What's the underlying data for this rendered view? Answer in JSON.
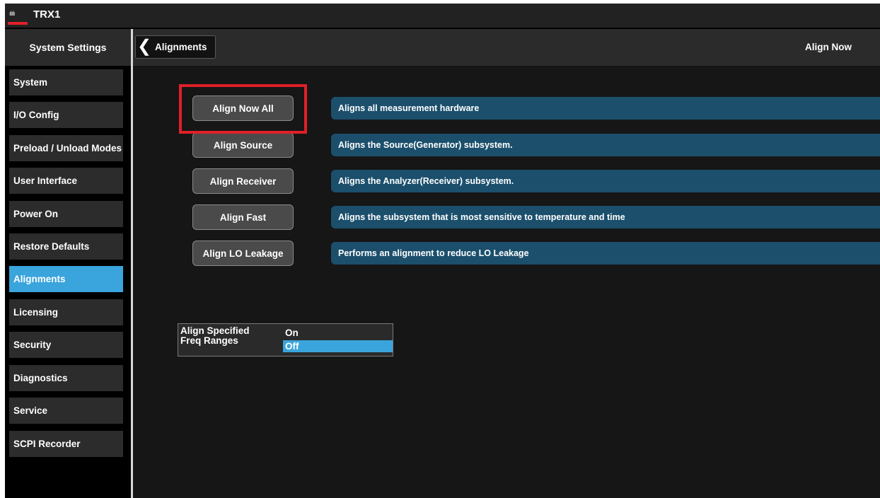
{
  "app": {
    "title": "TRX1",
    "logo_icon": "keysight-logo-icon",
    "accent_red": "#e0202a",
    "accent_blue": "#3aa4dc"
  },
  "sidebar": {
    "header": "System Settings",
    "items": [
      {
        "label": "System"
      },
      {
        "label": "I/O Config"
      },
      {
        "label": "Preload / Unload Modes"
      },
      {
        "label": "User Interface"
      },
      {
        "label": "Power On"
      },
      {
        "label": "Restore Defaults"
      },
      {
        "label": "Alignments",
        "active": true
      },
      {
        "label": "Licensing"
      },
      {
        "label": "Security"
      },
      {
        "label": "Diagnostics"
      },
      {
        "label": "Service"
      },
      {
        "label": "SCPI Recorder"
      }
    ]
  },
  "topbar": {
    "back_label": "Alignments",
    "back_icon": "chevron-left-icon",
    "right_label": "Align Now"
  },
  "align": {
    "rows": [
      {
        "button": "Align Now All",
        "desc": "Aligns all measurement hardware"
      },
      {
        "button": "Align Source",
        "desc": "Aligns the Source(Generator) subsystem."
      },
      {
        "button": "Align Receiver",
        "desc": "Aligns the Analyzer(Receiver) subsystem."
      },
      {
        "button": "Align Fast",
        "desc": "Aligns the subsystem that is most sensitive to temperature and time"
      },
      {
        "button": "Align LO Leakage",
        "desc": "Performs an alignment to reduce LO Leakage"
      }
    ]
  },
  "specified": {
    "label_line1": "Align Specified",
    "label_line2": "Freq Ranges",
    "options": [
      "On",
      "Off"
    ],
    "selected": "Off"
  }
}
